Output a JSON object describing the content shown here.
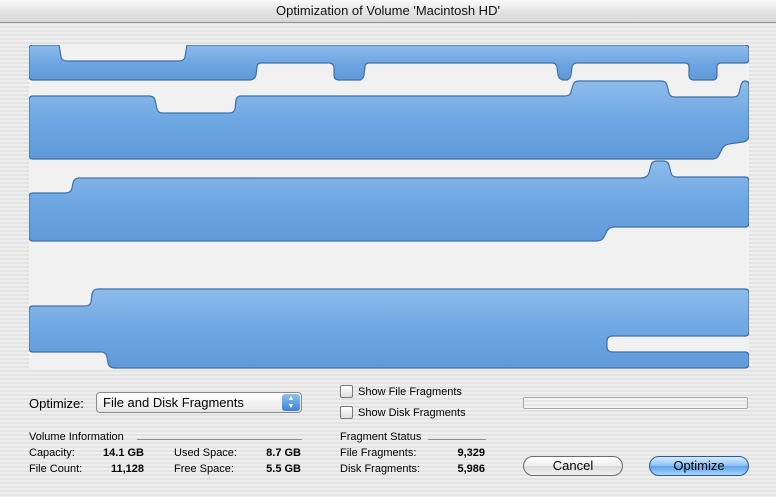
{
  "window": {
    "title": "Optimization of Volume 'Macintosh HD'"
  },
  "optimize": {
    "label": "Optimize:",
    "selected": "File and Disk Fragments"
  },
  "options": {
    "show_file_fragments": "Show File Fragments",
    "show_disk_fragments": "Show Disk Fragments"
  },
  "progress": {
    "value": 0
  },
  "volume_info": {
    "title": "Volume Information",
    "capacity_label": "Capacity:",
    "capacity": "14.1 GB",
    "file_count_label": "File Count:",
    "file_count": "11,128",
    "used_space_label": "Used Space:",
    "used_space": "8.7 GB",
    "free_space_label": "Free Space:",
    "free_space": "5.5 GB"
  },
  "fragment_status": {
    "title": "Fragment Status",
    "file_fragments_label": "File Fragments:",
    "file_fragments": "9,329",
    "disk_fragments_label": "Disk Fragments:",
    "disk_fragments": "5,986"
  },
  "buttons": {
    "cancel": "Cancel",
    "optimize": "Optimize"
  },
  "colors": {
    "block_fill": "#6ea7e3",
    "block_stroke": "#3f6fa6",
    "map_background": "#f1f1f1"
  }
}
